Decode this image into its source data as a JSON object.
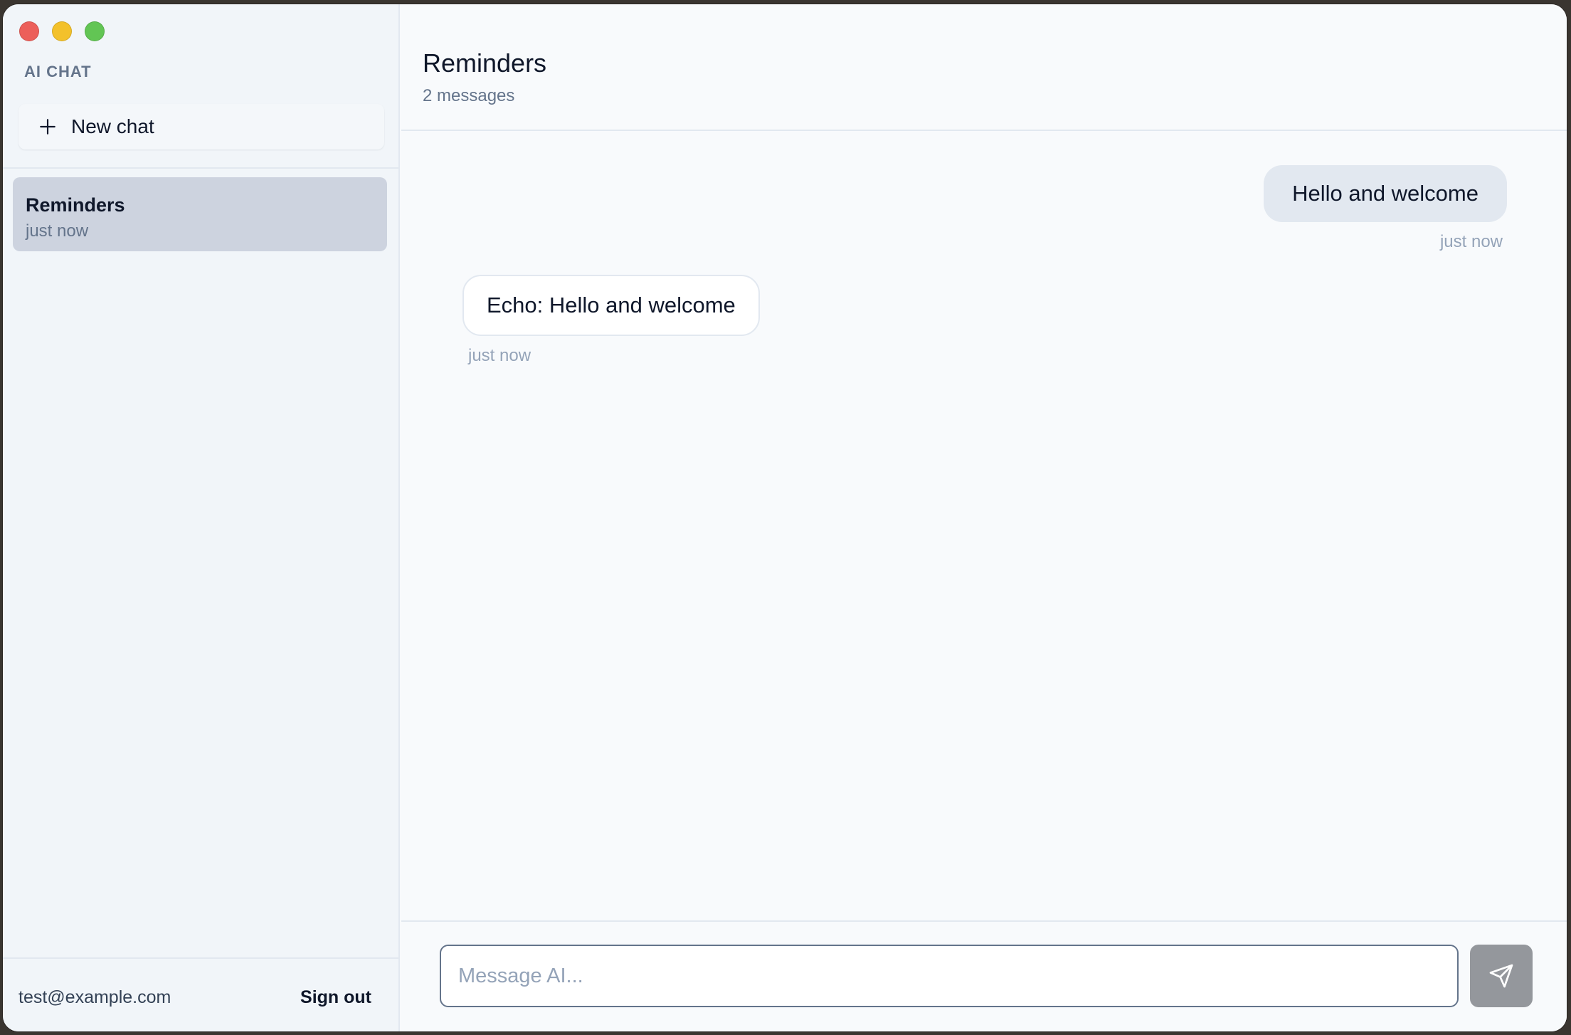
{
  "sidebar": {
    "brand": "AI CHAT",
    "new_chat_label": "New chat",
    "chats": [
      {
        "title": "Reminders",
        "time": "just now",
        "active": true
      }
    ],
    "user_email": "test@example.com",
    "sign_out_label": "Sign out"
  },
  "header": {
    "title": "Reminders",
    "subtitle": "2 messages"
  },
  "messages": [
    {
      "role": "user",
      "text": "Hello and welcome",
      "time": "just now"
    },
    {
      "role": "assistant",
      "text": "Echo: Hello and welcome",
      "time": "just now"
    }
  ],
  "composer": {
    "placeholder": "Message AI...",
    "value": ""
  },
  "icons": {
    "new_chat": "plus-icon",
    "send": "send-icon"
  },
  "colors": {
    "active_chat": "#cdd3df",
    "user_bubble": "#e2e8f0",
    "send_button": "#94979c"
  }
}
